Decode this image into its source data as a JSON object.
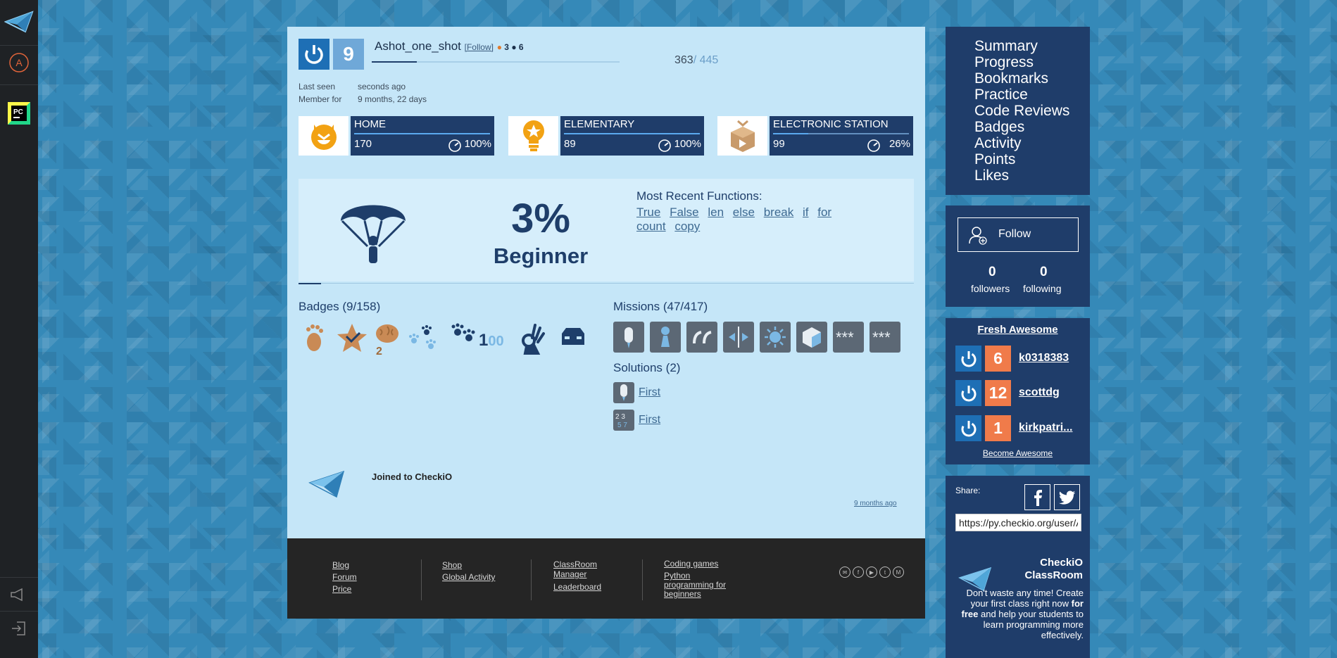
{
  "header": {
    "level": "9",
    "username": "Ashot_one_shot",
    "follow_link": "[Follow]",
    "stat_a": "3",
    "stat_b": "6",
    "score_current": "363",
    "score_total": "/ 445",
    "last_seen_label": "Last seen",
    "last_seen_value": "seconds ago",
    "member_label": "Member for",
    "member_value": "9 months, 22 days"
  },
  "stations": [
    {
      "name": "HOME",
      "count": "170",
      "percent": "100%",
      "progress": 100
    },
    {
      "name": "ELEMENTARY",
      "count": "89",
      "percent": "100%",
      "progress": 100
    },
    {
      "name": "ELECTRONIC STATION",
      "count": "99",
      "percent": "26%",
      "progress": 26
    }
  ],
  "rank": {
    "percent": "3%",
    "title": "Beginner",
    "recent_title": "Most Recent Functions:",
    "functions": [
      "True",
      "False",
      "len",
      "else",
      "break",
      "if",
      "for",
      "count",
      "copy"
    ]
  },
  "badges": {
    "title": "Badges (9/158)",
    "counter_text": "1",
    "counter_suffix": "00",
    "sub_2": "2"
  },
  "missions": {
    "title": "Missions (47/417)"
  },
  "solutions": {
    "title": "Solutions (2)",
    "items": [
      "First",
      "First"
    ]
  },
  "activity": {
    "joined": "Joined to CheckiO",
    "ago": "9 months ago"
  },
  "sidebar": {
    "menu": [
      "Summary",
      "Progress",
      "Bookmarks",
      "Practice",
      "Code Reviews",
      "Badges",
      "Activity",
      "Points",
      "Likes"
    ],
    "follow_label": "Follow",
    "followers_count": "0",
    "followers_label": "followers",
    "following_count": "0",
    "following_label": "following",
    "awesome_title": "Fresh Awesome",
    "awesome": [
      {
        "level": "6",
        "name": "k0318383"
      },
      {
        "level": "12",
        "name": "scottdg"
      },
      {
        "level": "1",
        "name": "kirkpatri..."
      }
    ],
    "become": "Become Awesome",
    "share_label": "Share:",
    "share_url": "https://py.checkio.org/user/Ashot_one_shot/",
    "classroom_title_1": "CheckiO",
    "classroom_title_2": "ClassRoom",
    "classroom_desc_1": "Don't waste any time! Create your first class right now",
    "classroom_desc_bold": "for free",
    "classroom_desc_2": "and help your students to learn programming more effectively."
  },
  "footer": {
    "col1": [
      "Blog",
      "Forum",
      "Price"
    ],
    "col2": [
      "Shop",
      "Global Activity"
    ],
    "col3": [
      "ClassRoom Manager",
      "Leaderboard"
    ],
    "col4": [
      "Coding games",
      "Python programming for beginners"
    ]
  },
  "colors": {
    "accent": "#1f3d6a",
    "avatar_blue": "#1e6fb5",
    "level_orange": "#f07b4a",
    "card_bg": "#c5e6f8"
  }
}
